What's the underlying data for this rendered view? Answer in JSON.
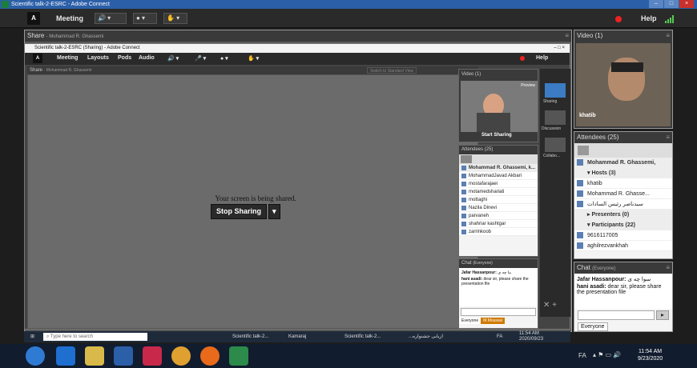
{
  "window": {
    "title": "Scientific talk-2-ESRC - Adobe Connect",
    "help": "Help"
  },
  "menubar": {
    "meeting": "Meeting",
    "logo": "Adobe"
  },
  "share": {
    "title": "Share",
    "presenter": "- Mohammad R. Ghassemi"
  },
  "inner": {
    "title": "Scientific talk-2-ESRC (Sharing) - Adobe Connect",
    "menus": [
      "Meeting",
      "Layouts",
      "Pods",
      "Audio"
    ],
    "help": "Help",
    "share_title": "Share",
    "share_presenter": "- Mohammad R. Ghassemi",
    "switch_label": "Switch to Standard View",
    "shared_msg": "Your screen is being shared.",
    "stop_sharing": "Stop Sharing",
    "video_title": "Video (1)",
    "preview": "Preview",
    "start_sharing": "Start Sharing",
    "side_labels": [
      "Sharing",
      "Discussion",
      "Collabo..."
    ],
    "attendees_title": "Attendees (25)",
    "attendees_presenter": "Mohammad R. Ghassemi, k...",
    "attendees": [
      "MohammadJavad Akbari",
      "mostafarajaei",
      "motamedshariati",
      "mottaghi",
      "Nazila Dinevi",
      "parvaneh",
      "shahriar kashtgar",
      "zarrinkoob"
    ],
    "chat_title": "Chat",
    "chat_scope": "(Everyone)",
    "chat_msgs": [
      {
        "who": "Jafar Hassanpour:",
        "text": "ببا چه ی"
      },
      {
        "who": "hani asadi:",
        "text": "dear sir, please share the presentation file"
      }
    ],
    "tabs": [
      "Everyone",
      "M.Mousavi"
    ]
  },
  "video": {
    "title": "Video (1)",
    "user": "khatib"
  },
  "attendees": {
    "title": "Attendees (25)",
    "presenter": "Mohammad R. Ghassemi, khatib",
    "hosts_label": "Hosts (3)",
    "hosts": [
      "khatib",
      "Mohammad R. Ghasse...",
      "سیدناصر رئیس السادات"
    ],
    "presenters_label": "Presenters (0)",
    "participants_label": "Participants (22)",
    "participants": [
      "9616117005",
      "aghilrezvankhah"
    ]
  },
  "chat": {
    "title": "Chat",
    "scope": "(Everyone)",
    "msgs": [
      {
        "who": "Jafar Hassanpour:",
        "text": "سوا چه ی"
      },
      {
        "who": "hani asadi:",
        "text": "dear sir, please share the presentation file"
      }
    ],
    "tab": "Everyone"
  },
  "taskbar_inner": {
    "search": "Type here to search",
    "apps": [
      "Scientific talk-2...",
      "Kamaraj",
      "Scientific talk-2...",
      "...ازیابی جشنواره"
    ],
    "lang": "FA",
    "time": "11:54 AM",
    "date": "2020/09/23"
  },
  "taskbar": {
    "lang": "FA",
    "time": "11:54 AM",
    "date": "9/23/2020"
  },
  "colors": {
    "accent": "#2b5fa8",
    "record": "#e22222",
    "taskbar": "#111c2e",
    "sharing_tab": "#d07a00"
  }
}
